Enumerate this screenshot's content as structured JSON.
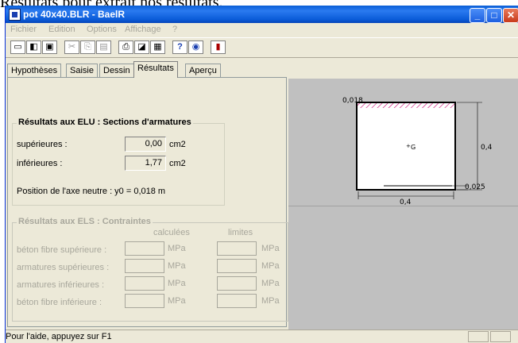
{
  "doc_text": "Résultats pour extrait nos résultats.",
  "window": {
    "title": "pot 40x40.BLR - BaelR",
    "buttons": {
      "minimize": "_",
      "maximize": "□",
      "close": "✕"
    }
  },
  "menu": [
    "Fichier",
    "Edition",
    "Options",
    "Affichage",
    "?"
  ],
  "toolbar_icons": [
    "new-icon",
    "open-icon",
    "save-icon",
    "cut-icon",
    "copy-icon",
    "paste-icon",
    "print-icon",
    "print-setup-icon",
    "properties-icon",
    "help-icon",
    "web-icon",
    "calculator-icon"
  ],
  "tabs": [
    "Hypothèses",
    "Saisie",
    "Dessin",
    "Résultats",
    "Aperçu"
  ],
  "active_tab": "Résultats",
  "elu": {
    "title": "Résultats aux ELU : Sections d'armatures",
    "rows": [
      {
        "label": "supérieures :",
        "value": "0,00",
        "unit": "cm2"
      },
      {
        "label": "inférieures :",
        "value": "1,77",
        "unit": "cm2"
      }
    ],
    "neutral_axis": "Position de l'axe neutre : y0 = 0,018 m"
  },
  "els": {
    "title": "Résultats aux ELS : Contraintes",
    "col_calc": "calculées",
    "col_lim": "limites",
    "unit": "MPa",
    "rows": [
      "béton fibre supérieure :",
      "armatures supérieures :",
      "armatures inférieures :",
      "béton fibre inférieure :"
    ]
  },
  "drawing": {
    "top_dim": "0,018",
    "height_dim": "0,4",
    "centroid": "G",
    "bottom_dim": "0,025",
    "width_dim": "0,4"
  },
  "status": "Pour l'aide, appuyez sur F1"
}
